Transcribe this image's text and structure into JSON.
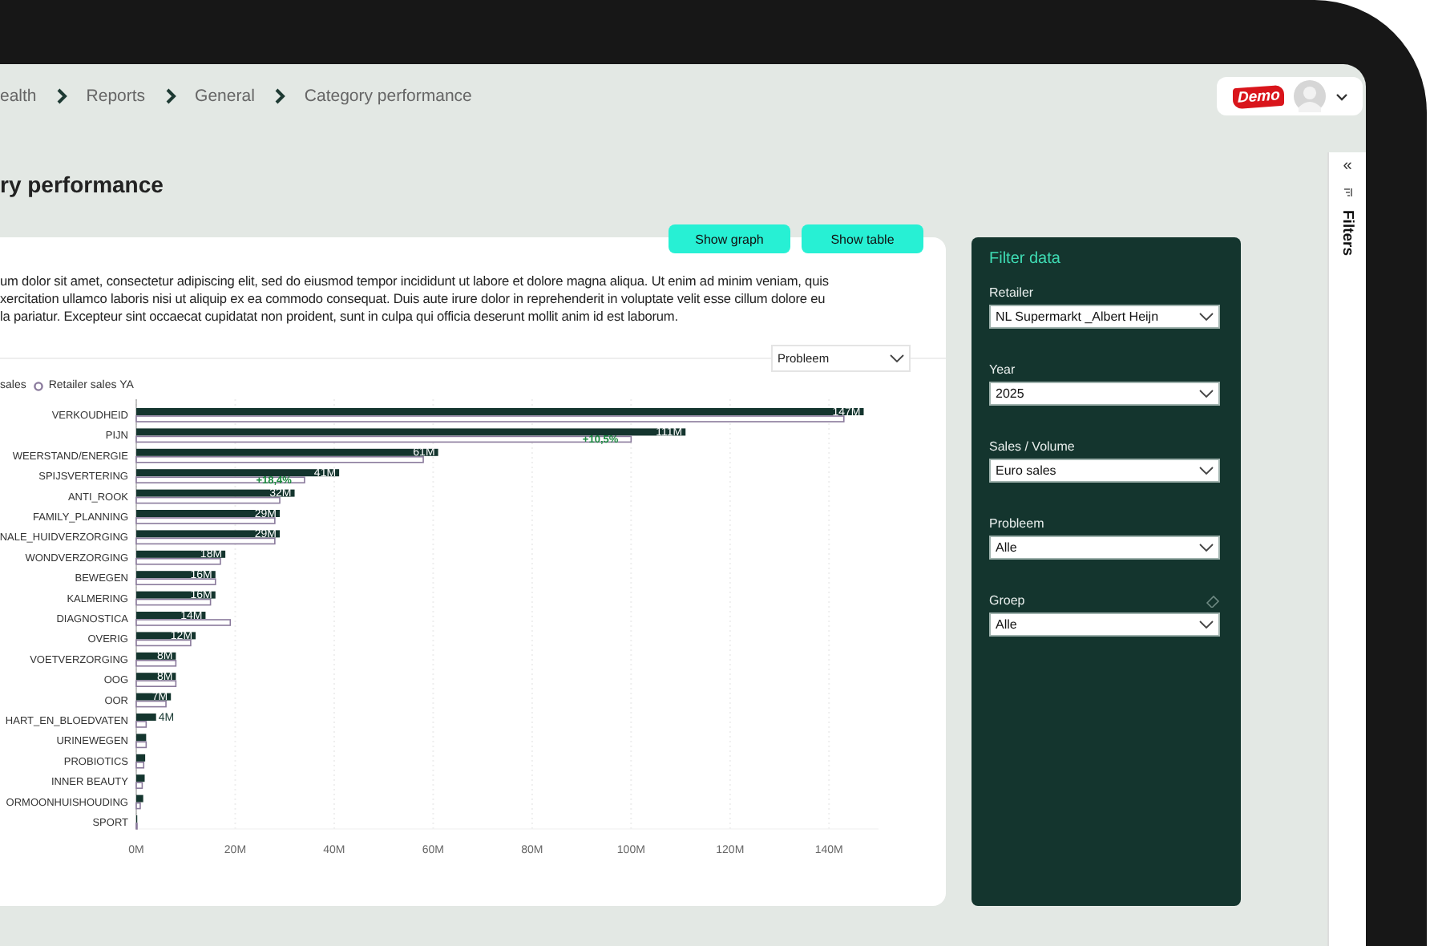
{
  "breadcrumb": [
    "ealth",
    "Reports",
    "General",
    "Category performance"
  ],
  "user": {
    "logo_text": "Demo"
  },
  "page_title": "ry performance",
  "view_buttons": [
    {
      "label": "Show graph"
    },
    {
      "label": "Show table"
    }
  ],
  "description": "um dolor sit amet, consectetur adipiscing elit, sed do eiusmod tempor incididunt ut labore et dolore magna aliqua. Ut enim ad minim veniam, quis\nxercitation ullamco laboris nisi ut aliquip ex ea commodo consequat. Duis aute irure dolor in reprehenderit in voluptate velit esse cillum dolore eu\nla pariatur. Excepteur sint occaecat cupidatat non proident, sunt in culpa qui officia deserunt mollit anim id est laborum.",
  "group_by": {
    "value": "Probleem"
  },
  "chart_data": {
    "type": "bar",
    "orientation": "horizontal",
    "categories": [
      "VERKOUDHEID",
      "PIJN",
      "WEERSTAND/ENERGIE",
      "SPIJSVERTERING",
      "ANTI_ROOK",
      "FAMILY_PLANNING",
      "NALE_HUIDVERZORGING",
      "WONDVERZORGING",
      "BEWEGEN",
      "KALMERING",
      "DIAGNOSTICA",
      "OVERIG",
      "VOETVERZORGING",
      "OOG",
      "OOR",
      "HART_EN_BLOEDVATEN",
      "URINEWEGEN",
      "PROBIOTICS",
      "INNER BEAUTY",
      "ORMOONHUISHOUDING",
      "SPORT"
    ],
    "series": [
      {
        "name": "sales",
        "color": "#14352e",
        "values": [
          147,
          111,
          61,
          41,
          32,
          29,
          29,
          18,
          16,
          16,
          14,
          12,
          8,
          8,
          7,
          4,
          2,
          1.8,
          1.7,
          1.4,
          0.2
        ]
      },
      {
        "name": "Retailer sales YA",
        "color": "#8a7a9c",
        "values": [
          143,
          100,
          58,
          34,
          29,
          28,
          28,
          17,
          16,
          15,
          19,
          11,
          8,
          8,
          6,
          2,
          2,
          1.5,
          1.2,
          0.8,
          0.1
        ]
      }
    ],
    "value_labels": [
      "147M",
      "111M",
      "61M",
      "41M",
      "32M",
      "29M",
      "29M",
      "18M",
      "16M",
      "16M",
      "14M",
      "12M",
      "8M",
      "8M",
      "7M",
      "4M",
      null,
      null,
      null,
      null,
      null
    ],
    "annotations": [
      {
        "y": "PIJN",
        "text": "+10,5%"
      },
      {
        "y": "SPIJSVERTERING",
        "text": "+18,4%"
      }
    ],
    "grid": true,
    "xlim": [
      0,
      150
    ],
    "xticks": [
      {
        "value": 0,
        "label": "0M"
      },
      {
        "value": 20,
        "label": "20M"
      },
      {
        "value": 40,
        "label": "40M"
      },
      {
        "value": 60,
        "label": "60M"
      },
      {
        "value": 80,
        "label": "80M"
      },
      {
        "value": 100,
        "label": "100M"
      },
      {
        "value": 120,
        "label": "120M"
      },
      {
        "value": 140,
        "label": "140M"
      }
    ]
  },
  "filter_panel": {
    "title": "Filter data",
    "fields": [
      {
        "label": "Retailer",
        "value": "NL Supermarkt _Albert Heijn",
        "clear_icon": false
      },
      {
        "label": "Year",
        "value": "2025",
        "clear_icon": false
      },
      {
        "label": "Sales / Volume",
        "value": "Euro sales",
        "clear_icon": false
      },
      {
        "label": "Probleem",
        "value": "Alle",
        "clear_icon": false
      },
      {
        "label": "Groep",
        "value": "Alle",
        "clear_icon": true
      }
    ]
  },
  "filters_pane": {
    "title": "Filters",
    "collapse_glyph": "«"
  }
}
